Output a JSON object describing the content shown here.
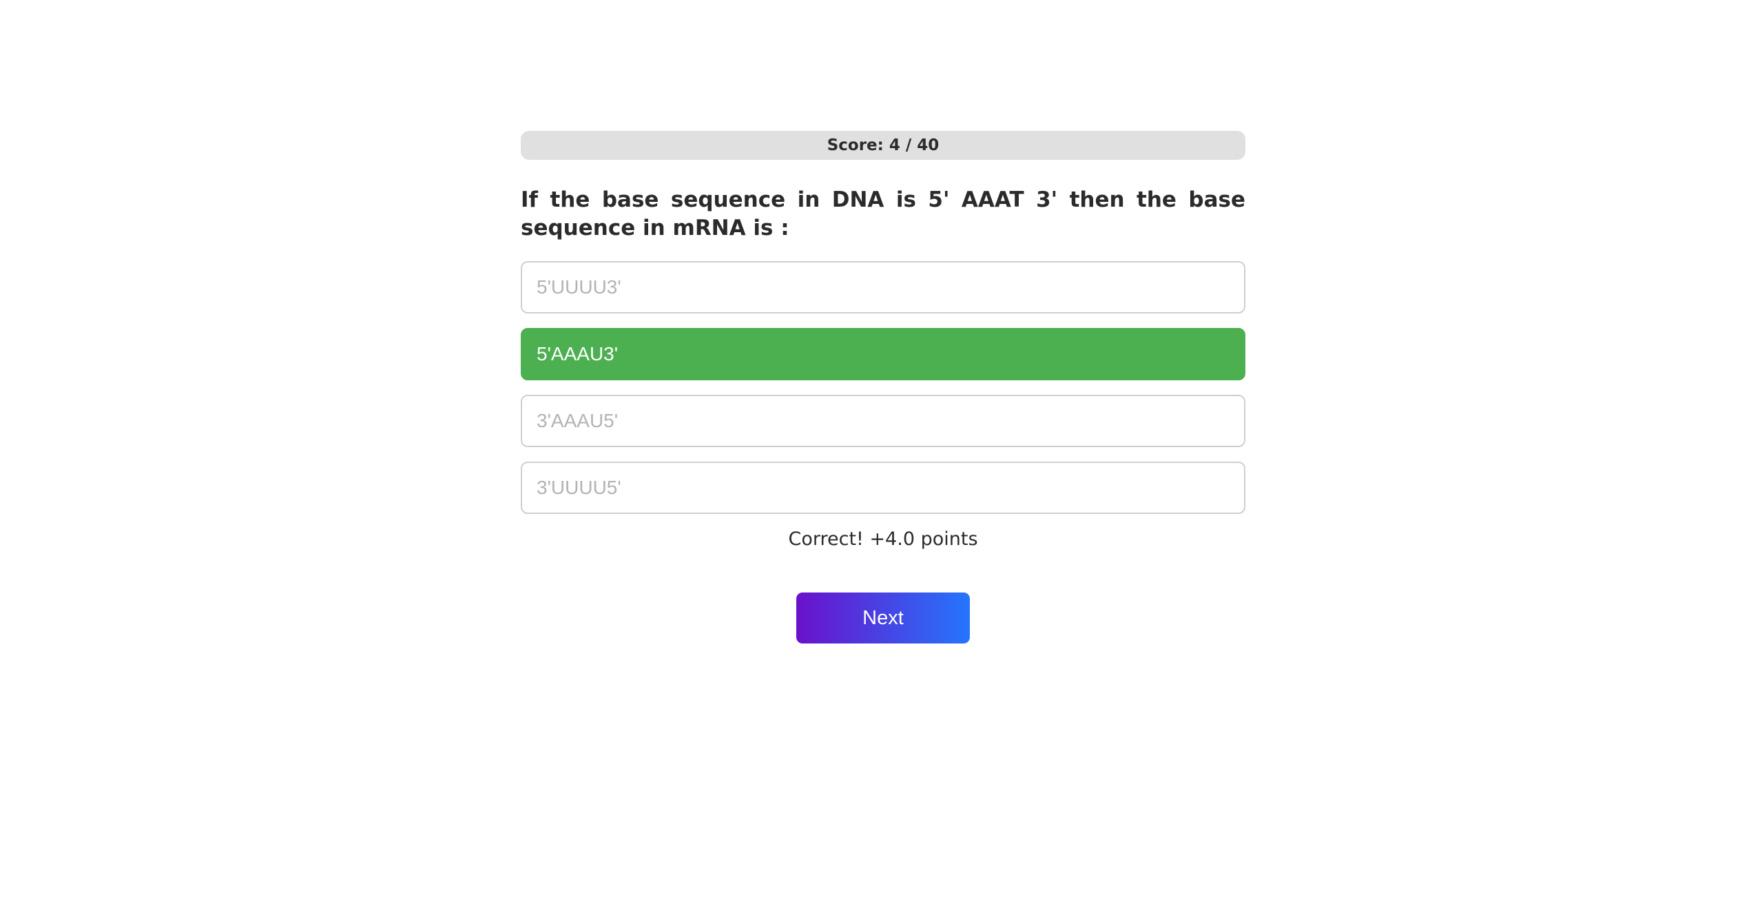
{
  "score": {
    "label": "Score: 4 / 40"
  },
  "question": {
    "text": "If the base sequence in DNA is 5' AAAT 3' then the base sequence in mRNA is :"
  },
  "options": [
    {
      "label": "5'UUUU3'",
      "state": "default"
    },
    {
      "label": "5'AAAU3'",
      "state": "correct"
    },
    {
      "label": "3'AAAU5'",
      "state": "default"
    },
    {
      "label": "3'UUUU5'",
      "state": "default"
    }
  ],
  "feedback": {
    "text": "Correct! +4.0 points"
  },
  "next_button": {
    "label": "Next"
  },
  "colors": {
    "correct": "#4caf50",
    "score_bar_bg": "#e0e0e0",
    "gradient_start": "#6a11cb",
    "gradient_end": "#2575fc"
  }
}
